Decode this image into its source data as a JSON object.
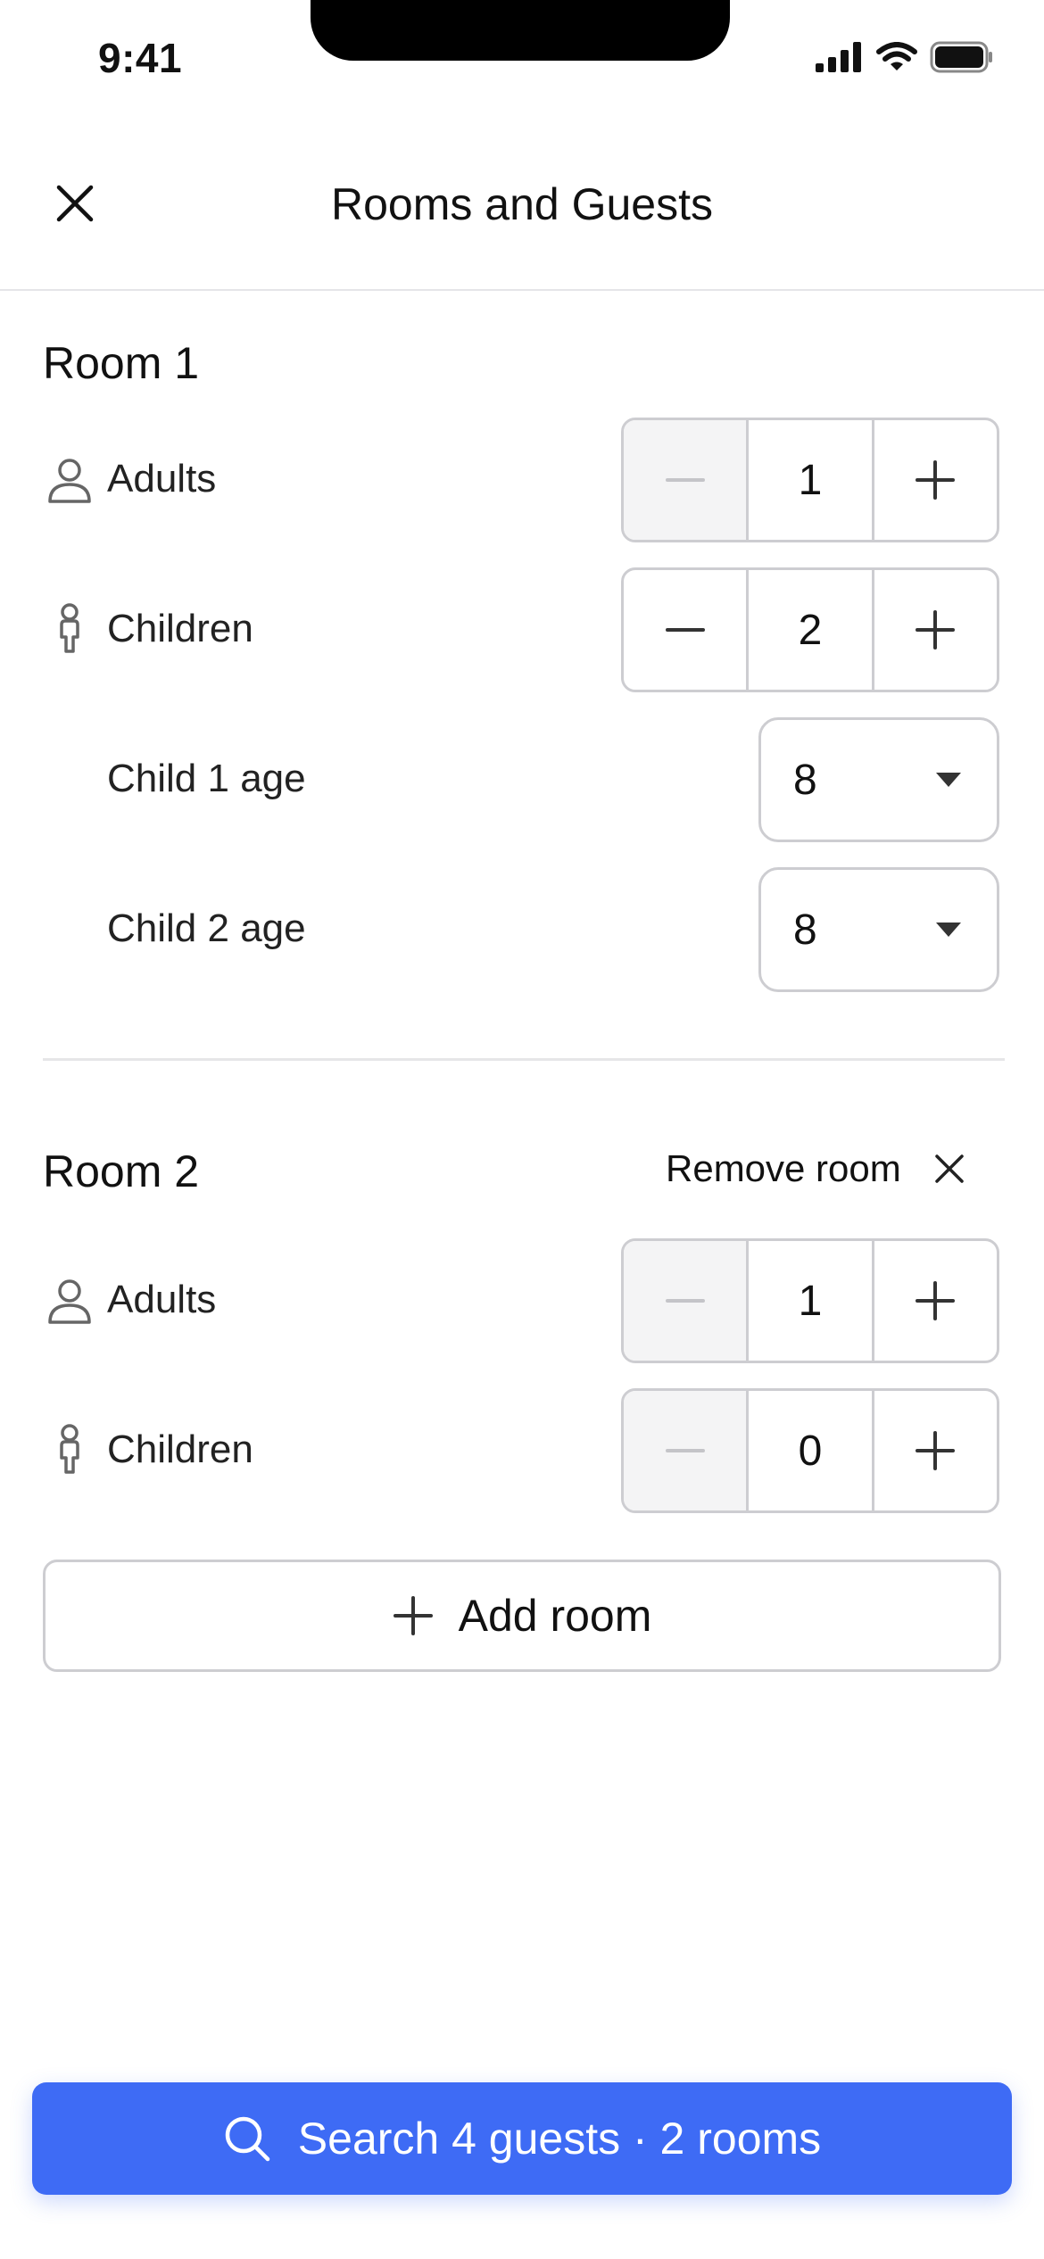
{
  "status_bar": {
    "time": "9:41"
  },
  "header": {
    "title": "Rooms and Guests"
  },
  "rooms": [
    {
      "title": "Room 1",
      "adults": {
        "label": "Adults",
        "value": "1"
      },
      "children": {
        "label": "Children",
        "value": "2"
      },
      "child_ages": [
        {
          "label": "Child 1 age",
          "value": "8"
        },
        {
          "label": "Child 2 age",
          "value": "8"
        }
      ]
    },
    {
      "title": "Room 2",
      "remove_label": "Remove room",
      "adults": {
        "label": "Adults",
        "value": "1"
      },
      "children": {
        "label": "Children",
        "value": "0"
      }
    }
  ],
  "add_room_label": "Add room",
  "search_button_label": "Search 4 guests · 2 rooms",
  "colors": {
    "accent": "#3e6bf5",
    "border": "#cdcdd1",
    "disabled_bg": "#f4f4f5"
  },
  "icons": [
    "close-icon",
    "person-icon",
    "child-icon",
    "minus-icon",
    "plus-icon",
    "chevron-down-icon",
    "search-icon",
    "signal-icon",
    "wifi-icon",
    "battery-icon"
  ]
}
